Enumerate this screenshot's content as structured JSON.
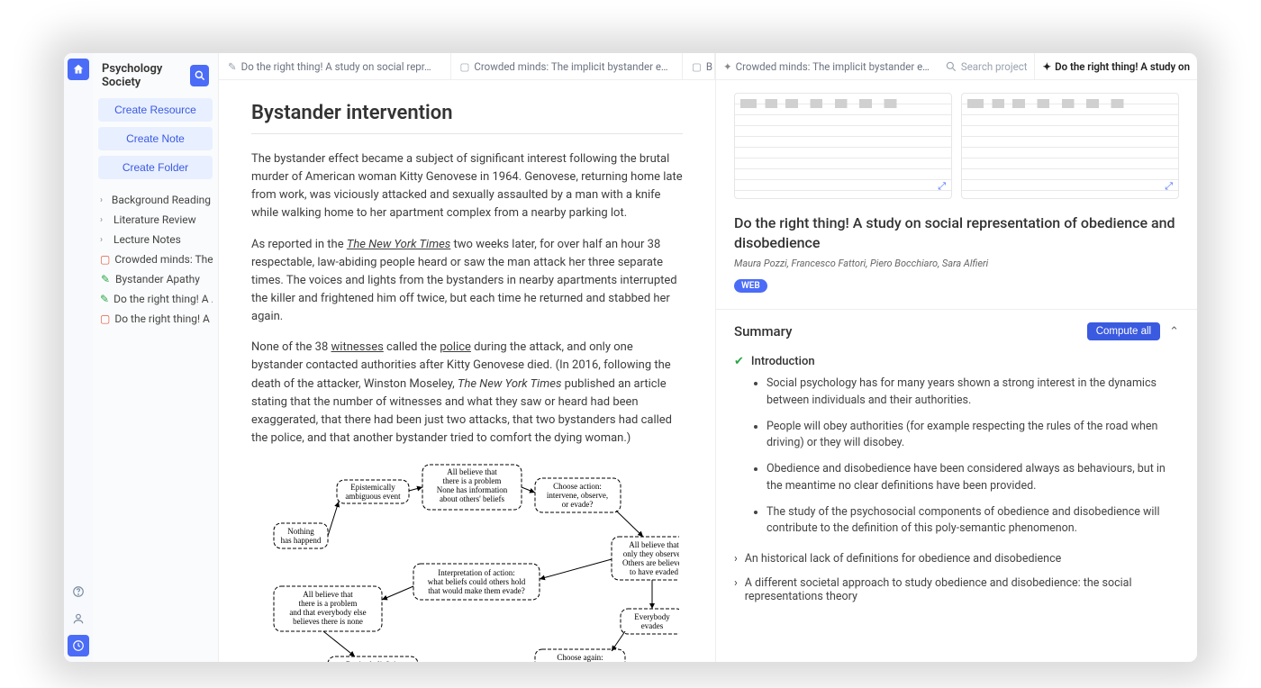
{
  "sidebar": {
    "project_title": "Psychology Society",
    "create_resource": "Create Resource",
    "create_note": "Create Note",
    "create_folder": "Create Folder",
    "tree": [
      {
        "type": "folder",
        "label": "Background Reading"
      },
      {
        "type": "folder",
        "label": "Literature Review"
      },
      {
        "type": "folder",
        "label": "Lecture Notes"
      },
      {
        "type": "file",
        "icon": "red",
        "label": "Crowded minds: The…"
      },
      {
        "type": "file",
        "icon": "green",
        "label": "Bystander Apathy"
      },
      {
        "type": "file",
        "icon": "green",
        "label": "Do the right thing! A …"
      },
      {
        "type": "file",
        "icon": "red",
        "label": "Do the right thing! A …"
      }
    ]
  },
  "tabs": {
    "main": [
      {
        "icon": "note",
        "label": "Do the right thing! A study on social repr…"
      },
      {
        "icon": "doc",
        "label": "Crowded minds: The implicit bystander e…"
      },
      {
        "icon": "doc",
        "label": "B"
      }
    ],
    "right": [
      {
        "icon": "sparkle",
        "label": "Crowded minds: The implicit bystander e…"
      },
      {
        "icon": "sparkle",
        "label": "Do the right thing! A study on",
        "bold": true
      }
    ],
    "search_placeholder": "Search project"
  },
  "document": {
    "title": "Bystander intervention",
    "p1": "The bystander effect became a subject of significant interest following the brutal murder of American woman Kitty Genovese in 1964. Genovese, returning home late from work, was viciously attacked and sexually assaulted by a man with a knife while walking home to her apartment complex from a nearby parking lot.",
    "p2a": "As reported in the ",
    "p2_link": "The New York Times",
    "p2b": " two weeks later, for over half an hour 38 respectable, law-abiding people heard or saw the man attack her three separate times. The voices and lights from the bystanders in nearby apartments interrupted the killer and frightened him off twice, but each time he returned and stabbed her again.",
    "p3a": "None of the 38 ",
    "p3_w": "witnesses",
    "p3b": " called the ",
    "p3_p": "police",
    "p3c": " during the attack, and only one bystander contacted authorities after Kitty Genovese died. (In 2016, following the death of the attacker, Winston Moseley, ",
    "p3_nyt": "The New York Times",
    "p3d": " published an article stating that the number of witnesses and what they saw or heard had been exaggerated, that there had been just two attacks, that two bystanders had called the police, and that another bystander tried to comfort the dying woman.)",
    "diagram_nodes": {
      "n1": "Epistemically\nambiguous event",
      "n2": "All believe that\nthere is a problem\nNone has information\nabout others' beliefs",
      "n3": "Choose action:\nintervene, observe,\nor evade?",
      "n4": "Nothing\nhas happend",
      "n5": "All believe that\nonly they observed\nOthers are believed\nto have evaded",
      "n6": "Interpretation of action:\nwhat beliefs could others hold\nthat would make them evade?",
      "n7": "All believe that\nthere is a problem\nand that everybody else\nbelieves there is none",
      "n8": "Everybody\nevades",
      "n9": "Revise beliefs in\nlight of social proof",
      "n10": "Choose again:\nintervene, observe,\nor evade?"
    }
  },
  "detail": {
    "title": "Do the right thing! A study on social representation of obedience and disobedience",
    "authors": "Maura Pozzi, Francesco Fattori, Piero Bocchiaro, Sara Alfieri",
    "badge": "WEB",
    "summary_label": "Summary",
    "compute_label": "Compute all",
    "intro_label": "Introduction",
    "intro_bullets": [
      "Social psychology has for many years shown a strong interest in the dynamics between individuals and their authorities.",
      "People will obey authorities (for example respecting the rules of the road when driving) or they will disobey.",
      "Obedience and disobedience have been considered always as behaviours, but in the meantime no clear definitions have been provided.",
      "The study of the psychosocial components of obedience and disobedience will contribute to the definition of this poly-semantic phenomenon."
    ],
    "sub1": "An historical lack of definitions for obedience and disobedience",
    "sub2": "A different societal approach to study obedience and disobedience: the social representations theory"
  }
}
